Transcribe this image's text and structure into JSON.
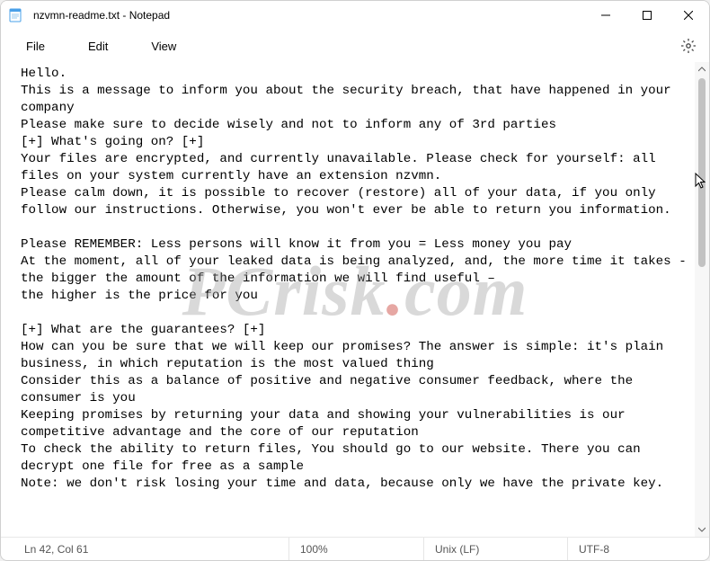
{
  "window": {
    "title": "nzvmn-readme.txt - Notepad"
  },
  "menu": {
    "file": "File",
    "edit": "Edit",
    "view": "View"
  },
  "document": {
    "text": "Hello.\nThis is a message to inform you about the security breach, that have happened in your company\nPlease make sure to decide wisely and not to inform any of 3rd parties\n[+] What's going on? [+]\nYour files are encrypted, and currently unavailable. Please check for yourself: all files on your system currently have an extension nzvmn.\nPlease calm down, it is possible to recover (restore) all of your data, if you only follow our instructions. Otherwise, you won't ever be able to return you information.\n\nPlease REMEMBER: Less persons will know it from you = Less money you pay\nAt the moment, all of your leaked data is being analyzed, and, the more time it takes -\nthe bigger the amount of the information we will find useful –\nthe higher is the price for you\n\n[+] What are the guarantees? [+]\nHow can you be sure that we will keep our promises? The answer is simple: it's plain business, in which reputation is the most valued thing\nConsider this as a balance of positive and negative consumer feedback, where the consumer is you\nKeeping promises by returning your data and showing your vulnerabilities is our competitive advantage and the core of our reputation\nTo check the ability to return files, You should go to our website. There you can decrypt one file for free as a sample\nNote: we don't risk losing your time and data, because only we have the private key."
  },
  "status": {
    "pos": "Ln 42, Col 61",
    "zoom": "100%",
    "eol": "Unix (LF)",
    "encoding": "UTF-8"
  },
  "watermark": {
    "pre": "PCrisk",
    "dot": ".",
    "post": "com"
  }
}
